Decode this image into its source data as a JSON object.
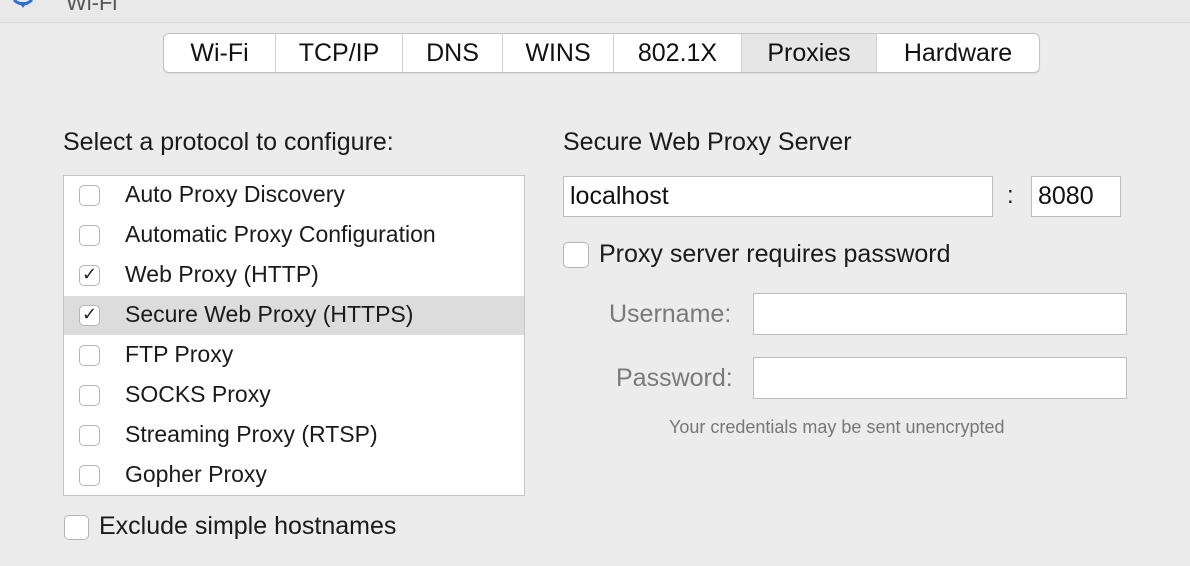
{
  "window": {
    "title_fragment": "Wi-Fi"
  },
  "tabs": [
    {
      "label": "Wi-Fi",
      "active": false
    },
    {
      "label": "TCP/IP",
      "active": false
    },
    {
      "label": "DNS",
      "active": false
    },
    {
      "label": "WINS",
      "active": false
    },
    {
      "label": "802.1X",
      "active": false
    },
    {
      "label": "Proxies",
      "active": true
    },
    {
      "label": "Hardware",
      "active": false
    }
  ],
  "protocols": {
    "heading": "Select a protocol to configure:",
    "items": [
      {
        "label": "Auto Proxy Discovery",
        "checked": false,
        "selected": false
      },
      {
        "label": "Automatic Proxy Configuration",
        "checked": false,
        "selected": false
      },
      {
        "label": "Web Proxy (HTTP)",
        "checked": true,
        "selected": false
      },
      {
        "label": "Secure Web Proxy (HTTPS)",
        "checked": true,
        "selected": true
      },
      {
        "label": "FTP Proxy",
        "checked": false,
        "selected": false
      },
      {
        "label": "SOCKS Proxy",
        "checked": false,
        "selected": false
      },
      {
        "label": "Streaming Proxy (RTSP)",
        "checked": false,
        "selected": false
      },
      {
        "label": "Gopher Proxy",
        "checked": false,
        "selected": false
      }
    ],
    "exclude_simple_hostnames": {
      "label": "Exclude simple hostnames",
      "checked": false
    }
  },
  "server": {
    "heading": "Secure Web Proxy Server",
    "host": "localhost",
    "colon": ":",
    "port": "8080",
    "requires_password": {
      "label": "Proxy server requires password",
      "checked": false
    },
    "username_label": "Username:",
    "username_value": "",
    "password_label": "Password:",
    "password_value": "",
    "note": "Your credentials may be sent unencrypted"
  },
  "icons": {
    "checkmark": "✓",
    "wifi": "wifi-icon"
  },
  "colors": {
    "background": "#ececec",
    "selected_row": "#dcdcdc",
    "active_tab": "#e6e6e6"
  }
}
